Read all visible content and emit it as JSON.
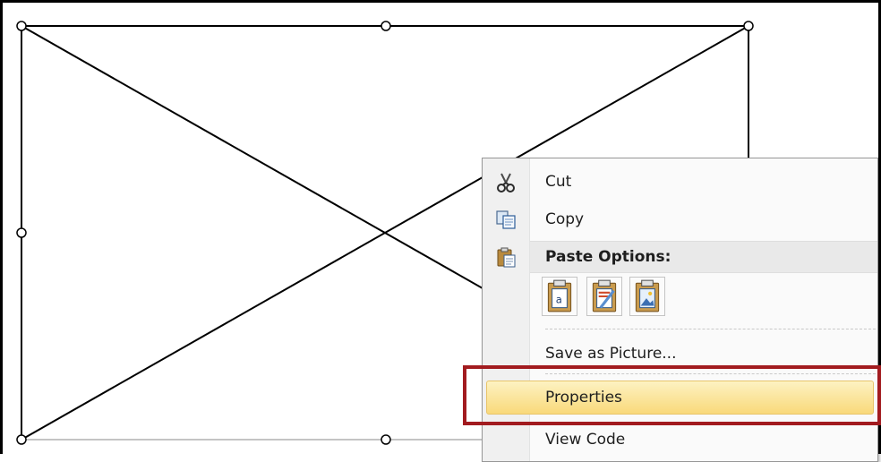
{
  "menu": {
    "cut_label": "Cut",
    "copy_label": "Copy",
    "paste_options_label": "Paste Options:",
    "save_as_picture_label": "Save as Picture...",
    "properties_label": "Properties",
    "view_code_label": "View Code"
  },
  "icons": {
    "cut": "scissors-icon",
    "copy": "copy-icon",
    "paste": "clipboard-icon",
    "paste_keep_text": "paste-keep-text-icon",
    "paste_formatting": "paste-formatting-icon",
    "paste_picture": "paste-picture-icon"
  },
  "colors": {
    "highlight_outline": "#a21b1f",
    "selected_item": "#f9d97a"
  }
}
